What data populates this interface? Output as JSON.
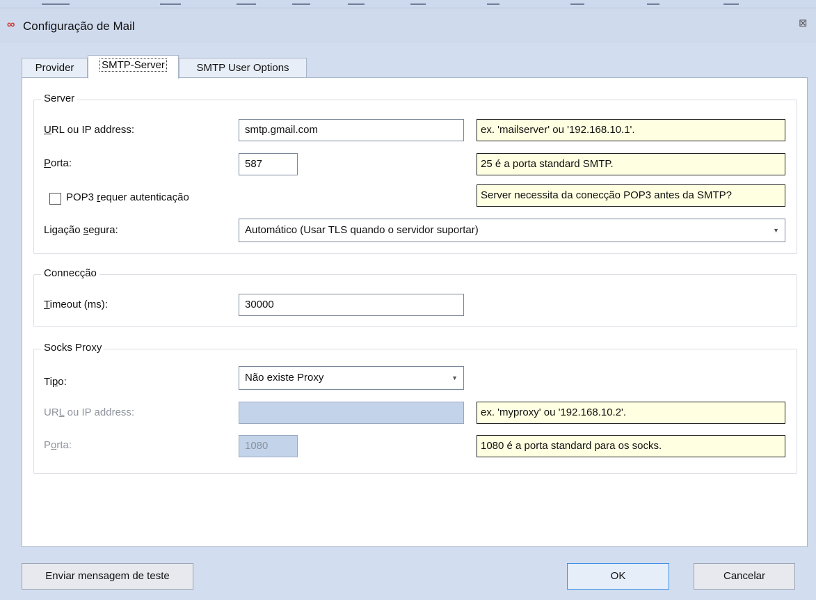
{
  "window": {
    "title": "Configuração de Mail"
  },
  "tabs": [
    {
      "label": "Provider"
    },
    {
      "label": "SMTP-Server",
      "active": true
    },
    {
      "label": "SMTP User Options"
    }
  ],
  "server": {
    "group_title": "Server",
    "url": {
      "mnemonic": "U",
      "label_rest": "RL ou IP address:",
      "value": "smtp.gmail.com",
      "hint": "ex. 'mailserver' ou '192.168.10.1'."
    },
    "port": {
      "mnemonic": "P",
      "label_rest": "orta:",
      "value": "587",
      "hint": "25 é a porta standard SMTP."
    },
    "pop3": {
      "label_pre": "POP3 ",
      "mnemonic": "r",
      "label_rest": "equer autenticação",
      "checked": false,
      "hint": "Server necessita da conecção POP3 antes da SMTP?"
    },
    "secure": {
      "label_pre": "Ligação ",
      "mnemonic": "s",
      "label_rest": "egura:",
      "value": "Automático (Usar TLS quando o servidor suportar)"
    }
  },
  "connection": {
    "group_title": "Connecção",
    "timeout": {
      "mnemonic": "T",
      "label_rest": "imeout (ms):",
      "value": "30000"
    }
  },
  "proxy": {
    "group_title": "Socks Proxy",
    "type": {
      "label_pre": "Ti",
      "mnemonic": "p",
      "label_rest": "o:",
      "value": "Não existe Proxy"
    },
    "url": {
      "label_pre": "UR",
      "mnemonic": "L",
      "label_rest": " ou IP address:",
      "value": "",
      "hint": "ex. 'myproxy' ou '192.168.10.2'."
    },
    "port": {
      "label_pre": "P",
      "mnemonic": "o",
      "label_rest": "rta:",
      "value": "1080",
      "hint": "1080 é a porta standard para os socks."
    }
  },
  "buttons": {
    "test": "Enviar mensagem de teste",
    "ok": "OK",
    "cancel": "Cancelar"
  },
  "colors": {
    "hint_background": "#ffffe1",
    "disabled_input": "#c2d3ea",
    "window_background": "#d2ddef"
  }
}
